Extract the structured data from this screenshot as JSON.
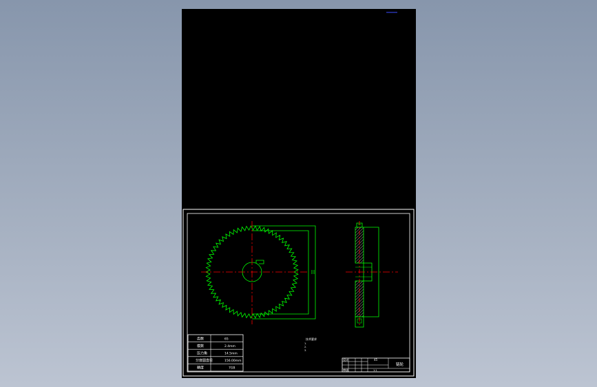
{
  "colors": {
    "background_top": "#8796ac",
    "background_bottom": "#bcc4d2",
    "sheet": "#000000",
    "frame": "#ffffff",
    "geometry": "#00ff00",
    "centerline": "#ff0000",
    "indicator": "#3b4cff"
  },
  "parameter_table": {
    "rows": [
      {
        "label": "齿数",
        "value": "65"
      },
      {
        "label": "模数",
        "value": "2.4mm"
      },
      {
        "label": "压力角",
        "value": "14.5mm"
      },
      {
        "label": "分度圆直径",
        "value": "156.00mm"
      },
      {
        "label": "精度",
        "value": "7GB"
      }
    ]
  },
  "title_block": {
    "name": "链轮",
    "label_a": "设计",
    "label_b": "审核",
    "material": "45",
    "scale": "1:1"
  },
  "notes": {
    "title": "技术要求",
    "lines": [
      "1.",
      "2.",
      "3."
    ]
  }
}
